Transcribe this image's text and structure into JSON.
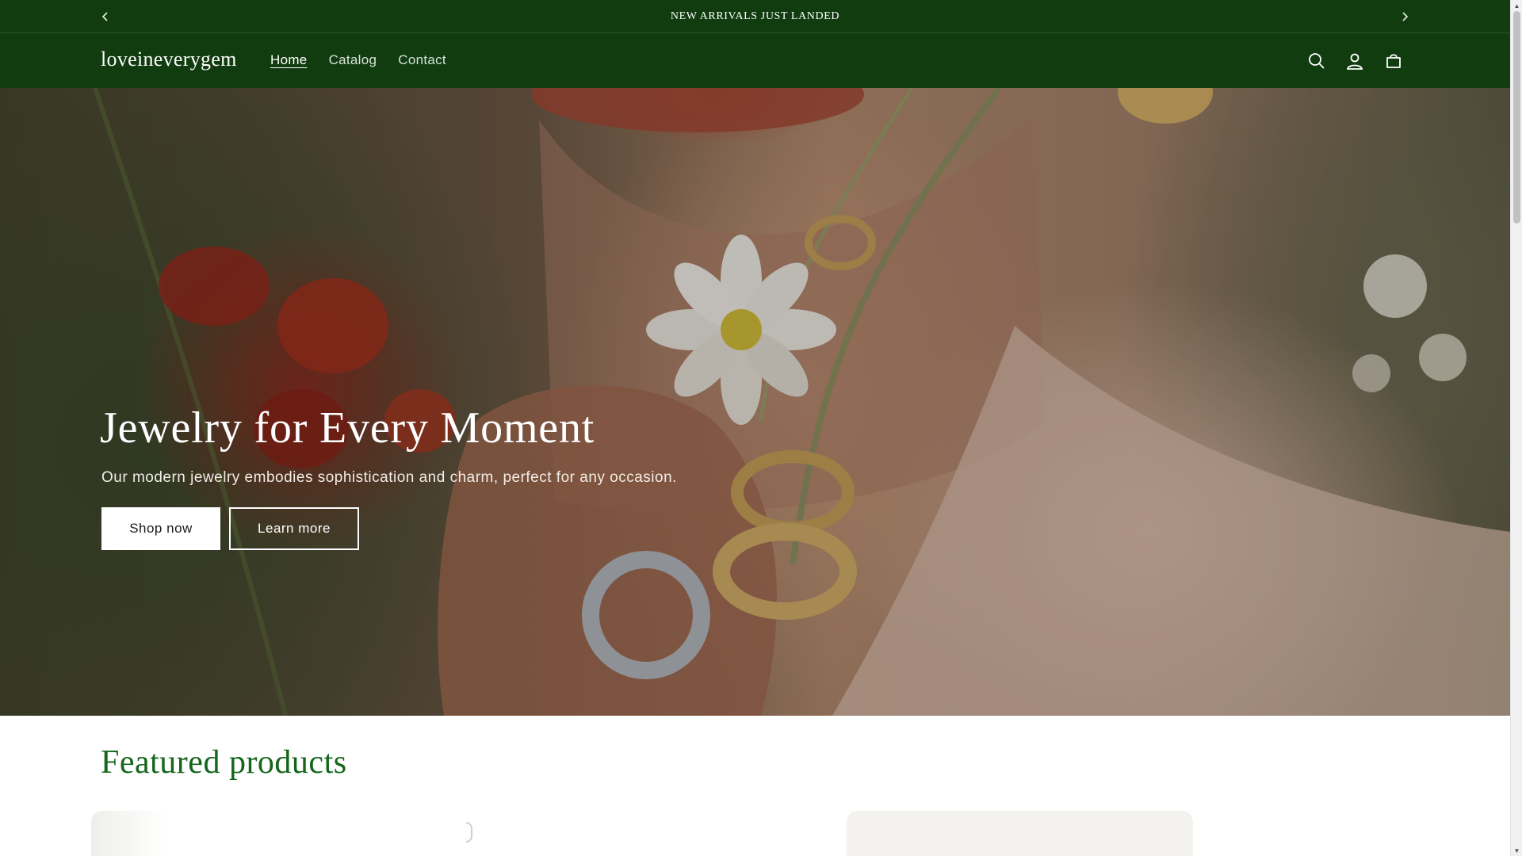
{
  "announcement": {
    "message": "NEW ARRIVALS JUST LANDED",
    "prev_icon": "chevron-left-icon",
    "next_icon": "chevron-right-icon"
  },
  "header": {
    "logo": "loveineverygem",
    "nav": [
      {
        "label": "Home",
        "active": true
      },
      {
        "label": "Catalog",
        "active": false
      },
      {
        "label": "Contact",
        "active": false
      }
    ],
    "icons": [
      "search-icon",
      "account-icon",
      "cart-icon"
    ]
  },
  "hero": {
    "title": "Jewelry for Every Moment",
    "subtitle": "Our modern jewelry embodies sophistication and charm, perfect for any occasion.",
    "primary_button": "Shop now",
    "secondary_button": "Learn more"
  },
  "featured": {
    "title": "Featured products"
  },
  "colors": {
    "brand_green": "#103c10",
    "heading_green": "#15661c",
    "white": "#ffffff"
  }
}
